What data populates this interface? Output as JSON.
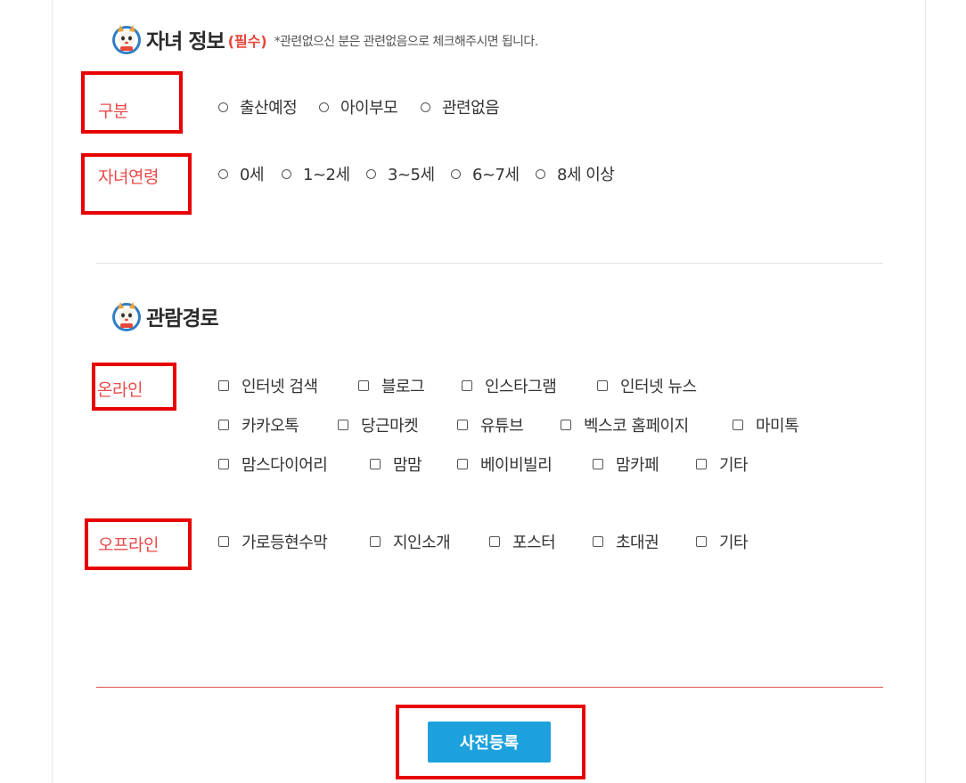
{
  "child_info": {
    "title": "자녀 정보",
    "required": "(필수)",
    "note": "*관련없으신 분은 관련없음으로 체크해주시면 됩니다.",
    "category": {
      "label": "구분",
      "options": [
        "출산예정",
        "아이부모",
        "관련없음"
      ]
    },
    "age": {
      "label": "자녀연령",
      "options": [
        "0세",
        "1~2세",
        "3~5세",
        "6~7세",
        "8세 이상"
      ]
    }
  },
  "route": {
    "title": "관람경로",
    "online": {
      "label": "온라인",
      "options": [
        "인터넷 검색",
        "블로그",
        "인스타그램",
        "인터넷 뉴스",
        "카카오톡",
        "당근마켓",
        "유튜브",
        "벡스코 홈페이지",
        "마미톡",
        "맘스다이어리",
        "맘맘",
        "베이비빌리",
        "맘카페",
        "기타"
      ]
    },
    "offline": {
      "label": "오프라인",
      "options": [
        "가로등현수막",
        "지인소개",
        "포스터",
        "초대권",
        "기타"
      ]
    }
  },
  "submit_label": "사전등록",
  "colors": {
    "accent": "#1da1dd",
    "label_red": "#ea4a4a",
    "highlight_box": "#e80000"
  },
  "icons": [
    "mascot-icon",
    "radio-icon",
    "checkbox-icon"
  ]
}
